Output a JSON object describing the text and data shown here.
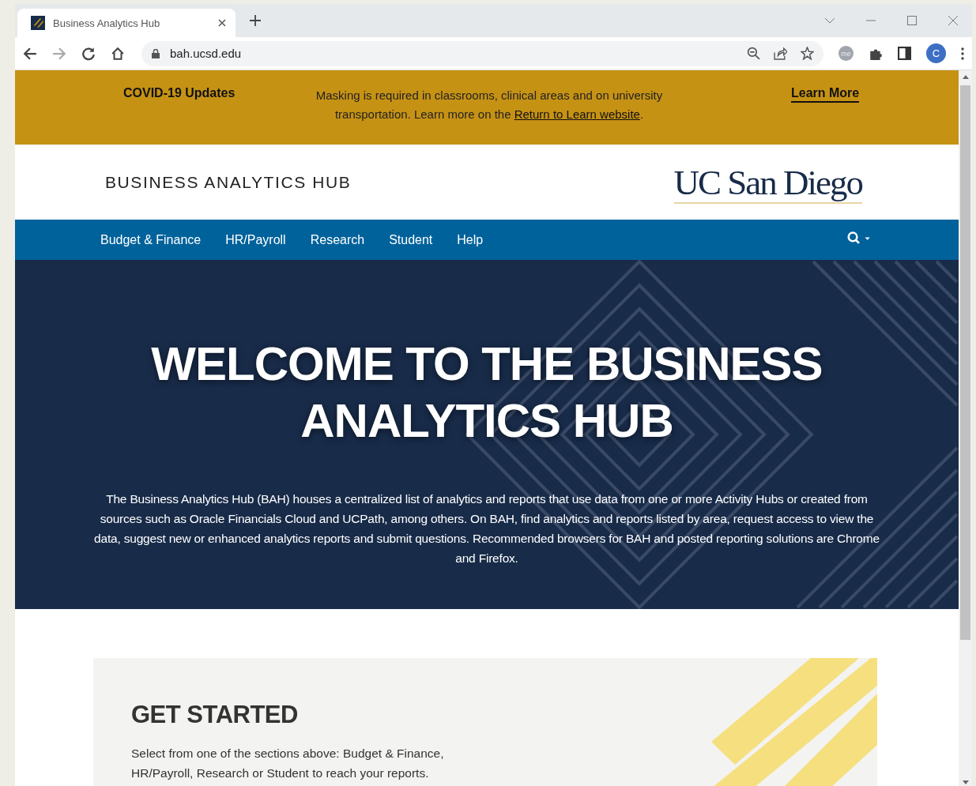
{
  "browser": {
    "tab_title": "Business Analytics Hub",
    "url": "bah.ucsd.edu",
    "profile_initial": "C",
    "extension_label": "me"
  },
  "banner": {
    "title": "COVID-19 Updates",
    "message": "Masking is required in classrooms, clinical areas and on university transportation. Learn more on the ",
    "link": "Return to Learn website",
    "message_end": ".",
    "cta": "Learn More"
  },
  "header": {
    "site_title": "BUSINESS ANALYTICS HUB",
    "logo": "UC San Diego"
  },
  "nav": {
    "items": [
      {
        "label": "Budget & Finance"
      },
      {
        "label": "HR/Payroll"
      },
      {
        "label": "Research"
      },
      {
        "label": "Student"
      },
      {
        "label": "Help"
      }
    ]
  },
  "hero": {
    "title": "WELCOME TO THE BUSINESS ANALYTICS HUB",
    "text": "The Business Analytics Hub (BAH) houses a centralized list of analytics and reports that use data from one or more Activity Hubs or created from sources such as Oracle Financials Cloud and UCPath, among others. On BAH, find analytics and reports listed by area, request access to view the data, suggest new or enhanced analytics reports and submit questions. Recommended browsers for BAH and posted reporting solutions are Chrome and Firefox."
  },
  "get_started": {
    "heading": "GET STARTED",
    "text": "Select from one of the sections above: Budget & Finance, HR/Payroll, Research or Student to reach your reports."
  }
}
